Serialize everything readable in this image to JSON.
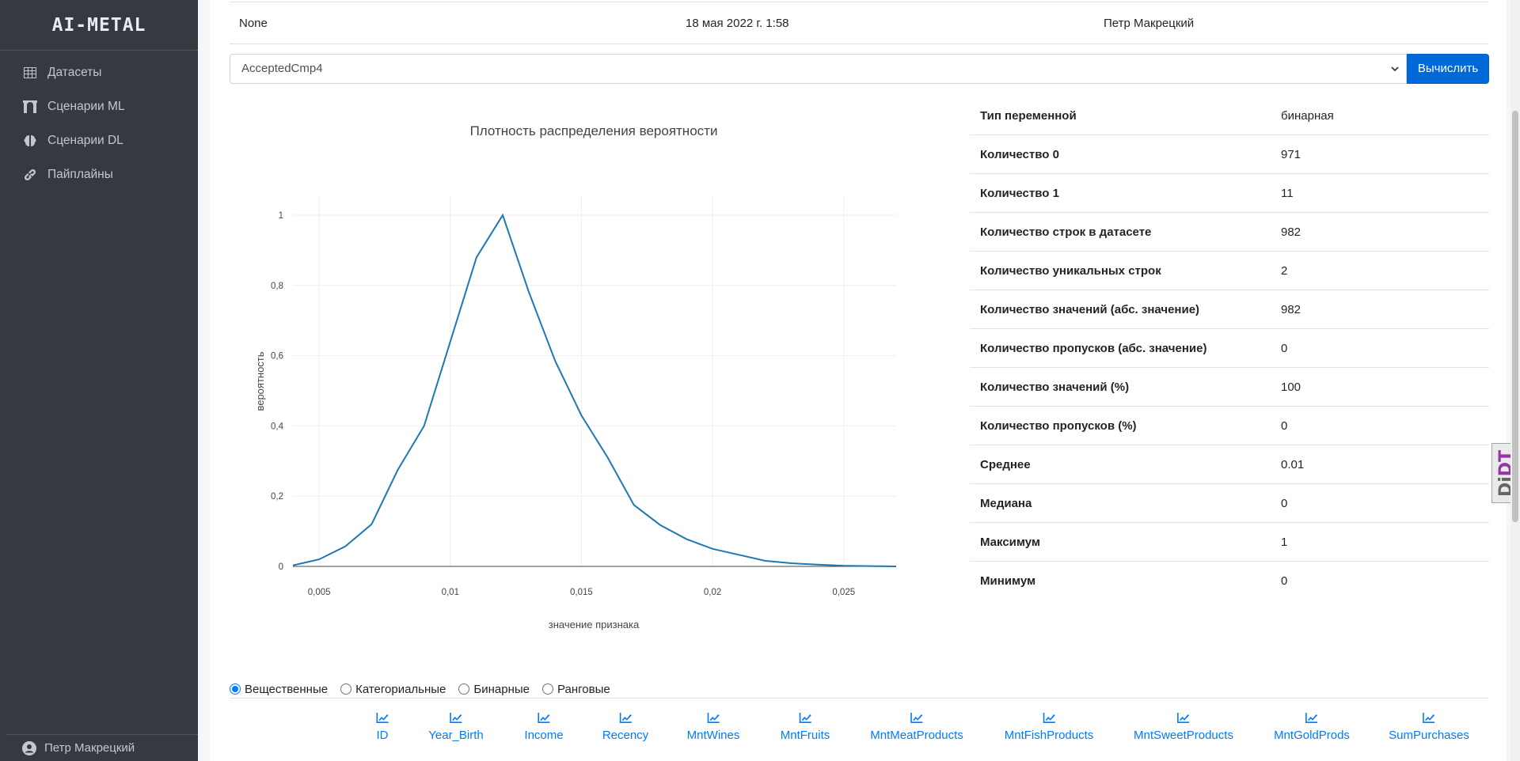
{
  "sidebar": {
    "brand": "AI-METAL",
    "items": [
      {
        "label": "Датасеты",
        "icon": "table-icon"
      },
      {
        "label": "Сценарии ML",
        "icon": "archway-icon"
      },
      {
        "label": "Сценарии DL",
        "icon": "brain-icon"
      },
      {
        "label": "Пайплайны",
        "icon": "link-icon"
      }
    ],
    "user": "Петр Макрецкий"
  },
  "info_row": {
    "description": "None",
    "date": "18 мая 2022 г. 1:58",
    "author": "Петр Макрецкий"
  },
  "target_select": {
    "value": "AcceptedCmp4"
  },
  "calc_button": "Вычислить",
  "chart_data": {
    "type": "line",
    "title": "Плотность распределения вероятности",
    "xlabel": "значение признака",
    "ylabel": "вероятность",
    "x_ticks": [
      "0,005",
      "0,01",
      "0,015",
      "0,02",
      "0,025"
    ],
    "y_ticks": [
      "0",
      "0,2",
      "0,4",
      "0,6",
      "0,8",
      "1"
    ],
    "xlim": [
      0.004,
      0.027
    ],
    "ylim": [
      0,
      1
    ],
    "grid": true,
    "line_color": "#1f77b4",
    "series": [
      {
        "x": [
          0.004,
          0.005,
          0.006,
          0.007,
          0.008,
          0.009,
          0.01,
          0.011,
          0.012,
          0.013,
          0.014,
          0.015,
          0.016,
          0.017,
          0.018,
          0.019,
          0.02,
          0.021,
          0.022,
          0.023,
          0.024,
          0.025,
          0.026,
          0.027
        ],
        "y": [
          0.003,
          0.02,
          0.057,
          0.12,
          0.275,
          0.4,
          0.64,
          0.88,
          1.0,
          0.78,
          0.585,
          0.43,
          0.31,
          0.175,
          0.118,
          0.078,
          0.05,
          0.033,
          0.016,
          0.009,
          0.005,
          0.002,
          0.001,
          0.0
        ]
      }
    ]
  },
  "stats": [
    {
      "key": "Тип переменной",
      "value": "бинарная"
    },
    {
      "key": "Количество 0",
      "value": "971"
    },
    {
      "key": "Количество 1",
      "value": "11"
    },
    {
      "key": "Количество строк в датасете",
      "value": "982"
    },
    {
      "key": "Количество уникальных строк",
      "value": "2"
    },
    {
      "key": "Количество значений (абс. значение)",
      "value": "982"
    },
    {
      "key": "Количество пропусков (абс. значение)",
      "value": "0"
    },
    {
      "key": "Количество значений (%)",
      "value": "100"
    },
    {
      "key": "Количество пропусков (%)",
      "value": "0"
    },
    {
      "key": "Среднее",
      "value": "0.01"
    },
    {
      "key": "Медиана",
      "value": "0"
    },
    {
      "key": "Максимум",
      "value": "1"
    },
    {
      "key": "Минимум",
      "value": "0"
    }
  ],
  "type_filter": {
    "options": [
      "Вещественные",
      "Категориальные",
      "Бинарные",
      "Ранговые"
    ],
    "selected": "Вещественные"
  },
  "features": [
    "ID",
    "Year_Birth",
    "Income",
    "Recency",
    "MntWines",
    "MntFruits",
    "MntMeatProducts",
    "MntFishProducts",
    "MntSweetProducts",
    "MntGoldProds",
    "SumPurchases"
  ],
  "debug_toolbar": {
    "label_a": "Dj",
    "label_b": "DT"
  },
  "colors": {
    "primary": "#007bff",
    "sidebar": "#343a40",
    "line": "#1f77b4"
  }
}
